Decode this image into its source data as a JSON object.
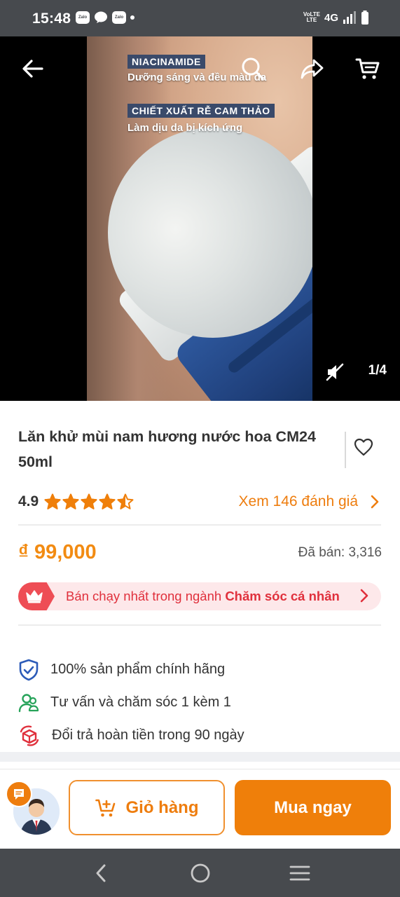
{
  "status_bar": {
    "time": "15:48",
    "app_chip_1": "Zalo",
    "app_chip_2": "Zalo",
    "network": "4G",
    "volte_top": "VoLTE",
    "volte_bottom": "LTE"
  },
  "gallery": {
    "counter": "1/4",
    "overlay": {
      "tag_1": "NIACINAMIDE",
      "line_1": "Dưỡng sáng và đều màu da",
      "tag_2": "CHIẾT XUẤT RỄ CAM THẢO",
      "line_2": "Làm dịu da bị kích ứng"
    }
  },
  "product": {
    "title": "Lăn khử mùi nam hương nước hoa CM24 50ml",
    "rating": "4.9",
    "stars": 4.5,
    "reviews_link": "Xem 146 đánh giá",
    "price": "₫ 99,000",
    "sold": "Đã bán: 3,316"
  },
  "best_seller": {
    "prefix": "Bán chạy nhất trong ngành ",
    "category": "Chăm sóc cá nhân"
  },
  "perks": [
    {
      "icon": "shield-check-icon",
      "label": "100% sản phẩm chính hãng"
    },
    {
      "icon": "people-icon",
      "label": "Tư vấn và chăm sóc 1 kèm 1"
    },
    {
      "icon": "return-box-icon",
      "label": "Đổi trả hoàn tiền trong 90 ngày"
    }
  ],
  "actions": {
    "cart_label": "Giỏ hàng",
    "buy_label": "Mua ngay"
  },
  "colors": {
    "accent": "#ef7f0a",
    "best_seller_red": "#ee4d55",
    "perk_blue": "#2c5bb8",
    "perk_green": "#27a35a",
    "perk_red": "#e0303c"
  }
}
